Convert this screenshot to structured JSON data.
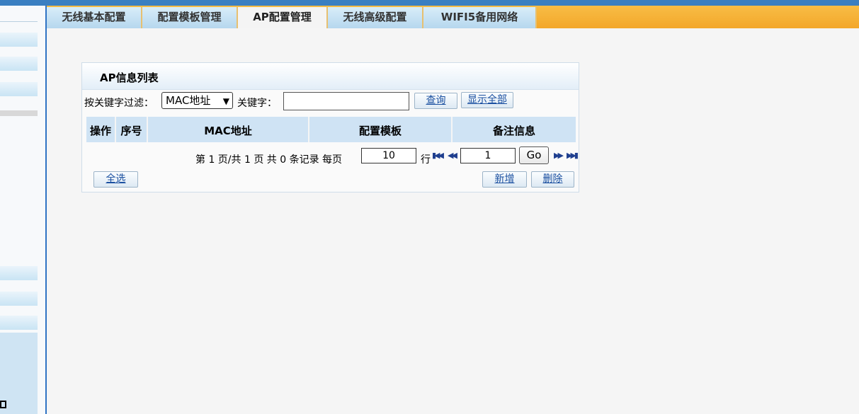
{
  "tabs": [
    {
      "label": "无线基本配置",
      "active": false
    },
    {
      "label": "配置模板管理",
      "active": false
    },
    {
      "label": "AP配置管理",
      "active": true
    },
    {
      "label": "无线高级配置",
      "active": false
    },
    {
      "label": "WIFI5备用网络",
      "active": false
    }
  ],
  "panel": {
    "title": "AP信息列表",
    "filter_label": "按关键字过滤：",
    "filter_select_value": "MAC地址",
    "keyword_label": "关键字：",
    "keyword_value": "",
    "search_button": "查询",
    "show_all_button": "显示全部"
  },
  "table": {
    "columns": [
      "操作",
      "序号",
      "MAC地址",
      "配置模板",
      "备注信息"
    ],
    "rows": []
  },
  "pagination": {
    "summary": "第 1 页/共 1 页 共 0 条记录 每页",
    "per_page": "10",
    "rows_unit": "行",
    "page_input": "1",
    "go_button": "Go",
    "icons": [
      "first-page-icon",
      "prev-page-icon",
      "next-page-icon",
      "last-page-icon"
    ]
  },
  "actions": {
    "select_all": "全选",
    "add": "新增",
    "delete": "删除"
  },
  "colors": {
    "tabbar_orange": "#f3a72b",
    "tab_blue": "#c6e2f5",
    "header_blue": "#cfe3f4",
    "accent_blue": "#2f73c4"
  }
}
